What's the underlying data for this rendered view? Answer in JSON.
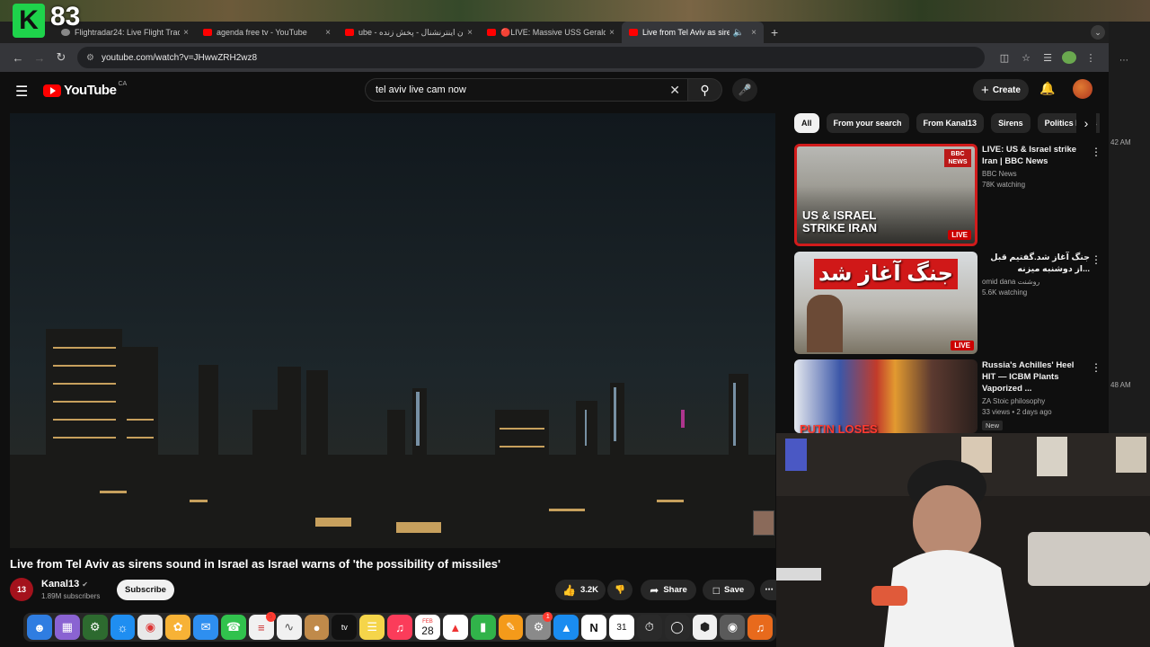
{
  "overlay": {
    "logo_letter": "K",
    "count": "83"
  },
  "browser": {
    "tabs": [
      {
        "label": "Flightradar24: Live Flight Track",
        "close": "×",
        "active": false,
        "favicon": "globe-icon"
      },
      {
        "label": "agenda free tv - YouTube",
        "close": "×",
        "active": false,
        "favicon": "youtube-icon"
      },
      {
        "label": "ube - ایران اینترنشنال - پخش زنده",
        "close": "×",
        "active": false,
        "favicon": "youtube-icon"
      },
      {
        "label": "🔴LIVE: Massive USS Gerald",
        "close": "×",
        "active": false,
        "favicon": "youtube-icon"
      },
      {
        "label": "Live from Tel Aviv as siren",
        "close": "×",
        "active": true,
        "favicon": "youtube-icon"
      }
    ],
    "url": "youtube.com/watch?v=JHwwZRH2wz8"
  },
  "side_times": [
    "42 AM",
    "48 AM"
  ],
  "youtube": {
    "logo_text": "YouTube",
    "country_code": "CA",
    "search_query": "tel aviv live cam now",
    "create_label": "Create",
    "video": {
      "title": "Live from Tel Aviv as sirens sound in Israel as Israel warns of 'the possibility of missiles'",
      "channel": "Kanal13",
      "channel_avatar_text": "13",
      "subscribers": "1.89M subscribers",
      "subscribe_label": "Subscribe",
      "likes": "3.2K",
      "share_label": "Share",
      "save_label": "Save"
    },
    "chips": [
      "All",
      "From your search",
      "From Kanal13",
      "Sirens",
      "Politics News"
    ],
    "recommendations": [
      {
        "title": "LIVE: US & Israel strike Iran | BBC News",
        "channel": "BBC News",
        "meta": "78K watching",
        "thumb_text": "US & ISRAEL STRIKE IRAN",
        "thumb_logo": "BBC NEWS",
        "badge": "LIVE"
      },
      {
        "title": "جنگ آغاز شد.گفتیم قبل از دوشنبه میزنه...",
        "channel": "omid dana روشنت",
        "meta": "5.6K watching",
        "thumb_text": "جنگ آغاز شد",
        "badge": "LIVE"
      },
      {
        "title": "Russia's Achilles' Heel HIT — ICBM Plants Vaporized ...",
        "channel": "ZA Stoic philosophy",
        "meta": "33 views • 2 days ago",
        "thumb_text": "PUTIN LOSES",
        "badge": "New"
      }
    ]
  },
  "dock": {
    "calendar_month": "FEB",
    "calendar_day": "28",
    "calendar2_day": "31",
    "badge_count_1": "5",
    "badge_count_2": "1",
    "tv_label": "tv",
    "notion_letter": "N"
  },
  "colors": {
    "accent": "#ff0000",
    "live": "#cc0000",
    "bg": "#0f0f0f",
    "overlay_green": "#1ed34b"
  }
}
